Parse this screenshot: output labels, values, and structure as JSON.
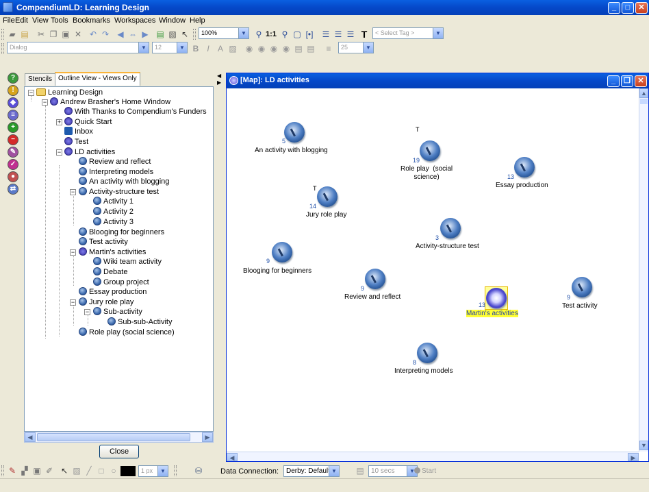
{
  "app": {
    "title": "CompendiumLD: Learning Design"
  },
  "menu": [
    "File",
    "Edit",
    "View",
    "Tools",
    "Bookmarks",
    "Workspaces",
    "Window",
    "Help"
  ],
  "toolbar": {
    "zoom_value": "100%",
    "zoom_fit_label": "1:1",
    "tag_placeholder": "< Select Tag >",
    "font_combo": "Dialog",
    "size_combo": "12",
    "width_combo": "25"
  },
  "left_panel": {
    "tabs": [
      "Stencils",
      "Outline View - Views Only"
    ],
    "active_tab": "Outline View - Views Only",
    "tree": [
      {
        "label": "Learning Design",
        "type": "folder"
      },
      {
        "label": "Andrew Brasher's Home Window",
        "type": "map"
      },
      {
        "label": "With Thanks to Compendium's Funders",
        "type": "map"
      },
      {
        "label": "Quick Start",
        "type": "map"
      },
      {
        "label": "Inbox",
        "type": "inbox"
      },
      {
        "label": "Test",
        "type": "map"
      },
      {
        "label": "LD activities",
        "type": "map"
      },
      {
        "label": "Review and reflect",
        "type": "issue"
      },
      {
        "label": "Interpreting models",
        "type": "issue"
      },
      {
        "label": "An activity with blogging",
        "type": "issue"
      },
      {
        "label": "Activity-structure test",
        "type": "issue"
      },
      {
        "label": "Activity 1",
        "type": "issue"
      },
      {
        "label": "Activity 2",
        "type": "issue"
      },
      {
        "label": "Activity 3",
        "type": "issue"
      },
      {
        "label": "Blooging for beginners",
        "type": "issue"
      },
      {
        "label": "Test activity",
        "type": "issue"
      },
      {
        "label": "Martin's activities",
        "type": "map"
      },
      {
        "label": "Wiki team activity",
        "type": "issue"
      },
      {
        "label": "Debate",
        "type": "issue"
      },
      {
        "label": "Group project",
        "type": "issue"
      },
      {
        "label": "Essay production",
        "type": "issue"
      },
      {
        "label": "Jury role play",
        "type": "issue"
      },
      {
        "label": "Sub-activity",
        "type": "issue"
      },
      {
        "label": "Sub-sub-Activity",
        "type": "issue"
      },
      {
        "label": "Role play  (social science)",
        "type": "issue"
      }
    ],
    "close_label": "Close"
  },
  "map_window": {
    "title": "[Map]: LD activities",
    "nodes": [
      {
        "id": "blogging",
        "label": "An activity with blogging",
        "count": "5",
        "tag": ""
      },
      {
        "id": "roleplay",
        "label": "Role play  (social\nscience)",
        "count": "19",
        "tag": "T"
      },
      {
        "id": "essay",
        "label": "Essay production",
        "count": "13",
        "tag": ""
      },
      {
        "id": "jury",
        "label": "Jury role play",
        "count": "14",
        "tag": "T"
      },
      {
        "id": "structure",
        "label": "Activity-structure test",
        "count": "3",
        "tag": ""
      },
      {
        "id": "blooging",
        "label": "Blooging for beginners",
        "count": "9",
        "tag": ""
      },
      {
        "id": "review",
        "label": "Review and reflect",
        "count": "9",
        "tag": ""
      },
      {
        "id": "martins",
        "label": "Martin's activities",
        "count": "13",
        "tag": "",
        "selected": true
      },
      {
        "id": "testact",
        "label": "Test activity",
        "count": "9",
        "tag": ""
      },
      {
        "id": "interp",
        "label": "Interpreting models",
        "count": "8",
        "tag": ""
      }
    ]
  },
  "bottom_toolbar": {
    "line_width": "1 px",
    "data_connection_label": "Data Connection:",
    "data_connection_value": "Derby: Default",
    "interval": "10 secs",
    "start_label": "Start"
  },
  "colors": {
    "title_blue": "#0548C9",
    "selection_yellow": "#FFFF33",
    "node_count_blue": "#1F4FA8"
  }
}
